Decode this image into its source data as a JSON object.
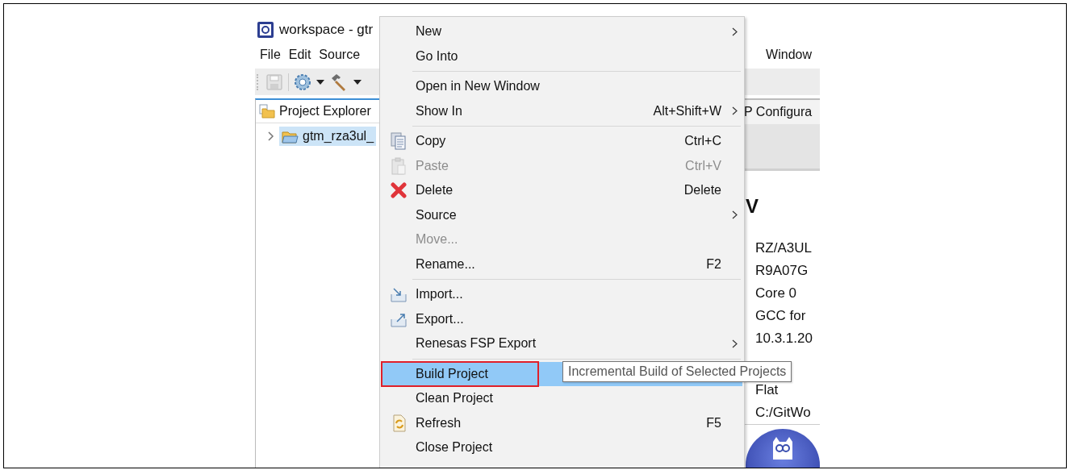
{
  "window": {
    "title": "workspace - gtr"
  },
  "menubar": [
    "File",
    "Edit",
    "Source",
    "Window"
  ],
  "project_explorer": {
    "tab_label": "Project Explorer",
    "items": [
      {
        "label": "gtm_rza3ul_",
        "selected": true,
        "expanded": false
      }
    ]
  },
  "editor": {
    "tab_label": "P Configura",
    "heading": "V",
    "properties": [
      "RZ/A3UL",
      "R9A07G",
      "Core 0",
      "GCC for",
      "10.3.1.20",
      "Flat",
      "C:/GitWo"
    ]
  },
  "context_menu": {
    "items": [
      {
        "kind": "item",
        "label": "New",
        "submenu": true,
        "disabled": false,
        "selected": false,
        "boxed": false
      },
      {
        "kind": "item",
        "label": "Go Into",
        "submenu": false,
        "disabled": false,
        "selected": false,
        "boxed": false
      },
      {
        "kind": "separator"
      },
      {
        "kind": "item",
        "label": "Open in New Window",
        "submenu": false,
        "disabled": false,
        "selected": false,
        "boxed": false
      },
      {
        "kind": "item",
        "label": "Show In",
        "shortcut": "Alt+Shift+W",
        "submenu": true,
        "disabled": false,
        "selected": false,
        "boxed": false
      },
      {
        "kind": "separator"
      },
      {
        "kind": "item",
        "label": "Copy",
        "shortcut": "Ctrl+C",
        "submenu": false,
        "disabled": false,
        "selected": false,
        "boxed": false
      },
      {
        "kind": "item",
        "label": "Paste",
        "shortcut": "Ctrl+V",
        "submenu": false,
        "disabled": true,
        "selected": false,
        "boxed": false
      },
      {
        "kind": "item",
        "label": "Delete",
        "shortcut": "Delete",
        "submenu": false,
        "disabled": false,
        "selected": false,
        "boxed": false
      },
      {
        "kind": "item",
        "label": "Source",
        "submenu": true,
        "disabled": false,
        "selected": false,
        "boxed": false
      },
      {
        "kind": "item",
        "label": "Move...",
        "submenu": false,
        "disabled": true,
        "selected": false,
        "boxed": false
      },
      {
        "kind": "item",
        "label": "Rename...",
        "shortcut": "F2",
        "submenu": false,
        "disabled": false,
        "selected": false,
        "boxed": false
      },
      {
        "kind": "separator"
      },
      {
        "kind": "item",
        "label": "Import...",
        "submenu": false,
        "disabled": false,
        "selected": false,
        "boxed": false
      },
      {
        "kind": "item",
        "label": "Export...",
        "submenu": false,
        "disabled": false,
        "selected": false,
        "boxed": false
      },
      {
        "kind": "item",
        "label": "Renesas FSP Export",
        "submenu": true,
        "disabled": false,
        "selected": false,
        "boxed": false
      },
      {
        "kind": "separator"
      },
      {
        "kind": "item",
        "label": "Build Project",
        "submenu": false,
        "disabled": false,
        "selected": true,
        "boxed": true
      },
      {
        "kind": "item",
        "label": "Clean Project",
        "submenu": false,
        "disabled": false,
        "selected": false,
        "boxed": false
      },
      {
        "kind": "item",
        "label": "Refresh",
        "shortcut": "F5",
        "submenu": false,
        "disabled": false,
        "selected": false,
        "boxed": false
      },
      {
        "kind": "item",
        "label": "Close Project",
        "submenu": false,
        "disabled": false,
        "selected": false,
        "boxed": false
      }
    ]
  },
  "tooltip": "Incremental Build of Selected Projects"
}
